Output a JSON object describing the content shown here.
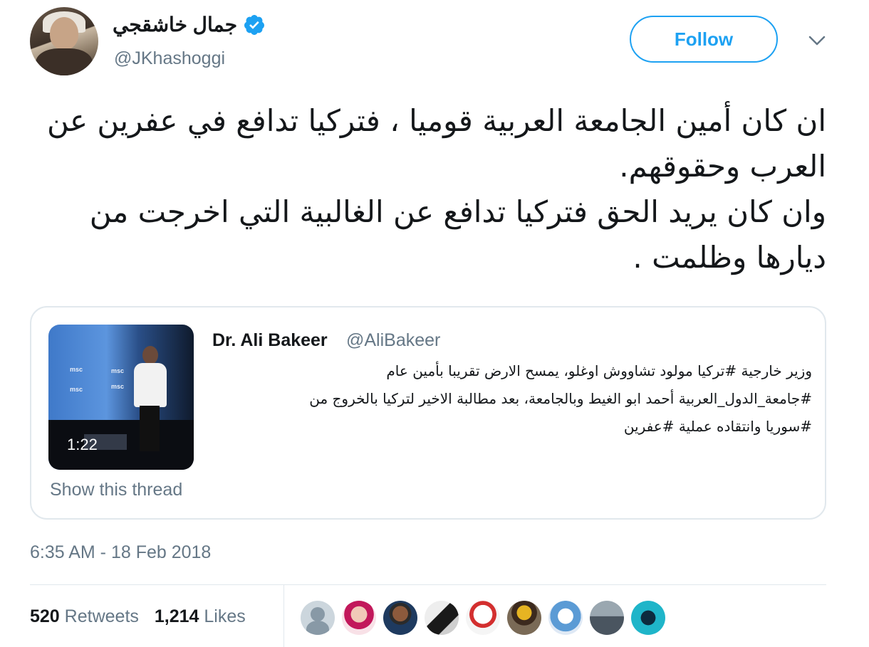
{
  "author": {
    "name": "جمال خاشقجي",
    "handle": "@JKhashoggi",
    "verified_icon": "verified-badge-icon",
    "accent_color": "#1da1f2"
  },
  "follow_button": {
    "label": "Follow"
  },
  "menu": {
    "icon": "chevron-down-icon"
  },
  "tweet": {
    "lines": [
      "ان كان أمين الجامعة العربية قوميا ، فتركيا تدافع في عفرين عن العرب وحقوقهم.",
      "وان كان يريد الحق فتركيا تدافع عن الغالبية التي اخرجت من ديارها وظلمت ."
    ]
  },
  "quoted_tweet": {
    "author_name": "Dr. Ali Bakeer",
    "author_handle": "@AliBakeer",
    "video_duration": "1:22",
    "lines": [
      "وزير خارجية #تركيا مولود تشاووش اوغلو، يمسح الارض تقريبا بأمين عام",
      "#جامعة_الدول_العربية أحمد ابو الغيط وبالجامعة، بعد مطالبة الاخير لتركيا بالخروج من",
      "#سوريا وانتقاده عملية #عفرين"
    ],
    "show_thread_label": "Show this thread"
  },
  "timestamp": "6:35 AM - 18 Feb 2018",
  "stats": {
    "retweets_count": "520",
    "retweets_label": "Retweets",
    "likes_count": "1,214",
    "likes_label": "Likes"
  },
  "likers": [
    "liker-1",
    "liker-2",
    "liker-3",
    "liker-4",
    "liker-5",
    "liker-6",
    "liker-7",
    "liker-8",
    "liker-9"
  ]
}
